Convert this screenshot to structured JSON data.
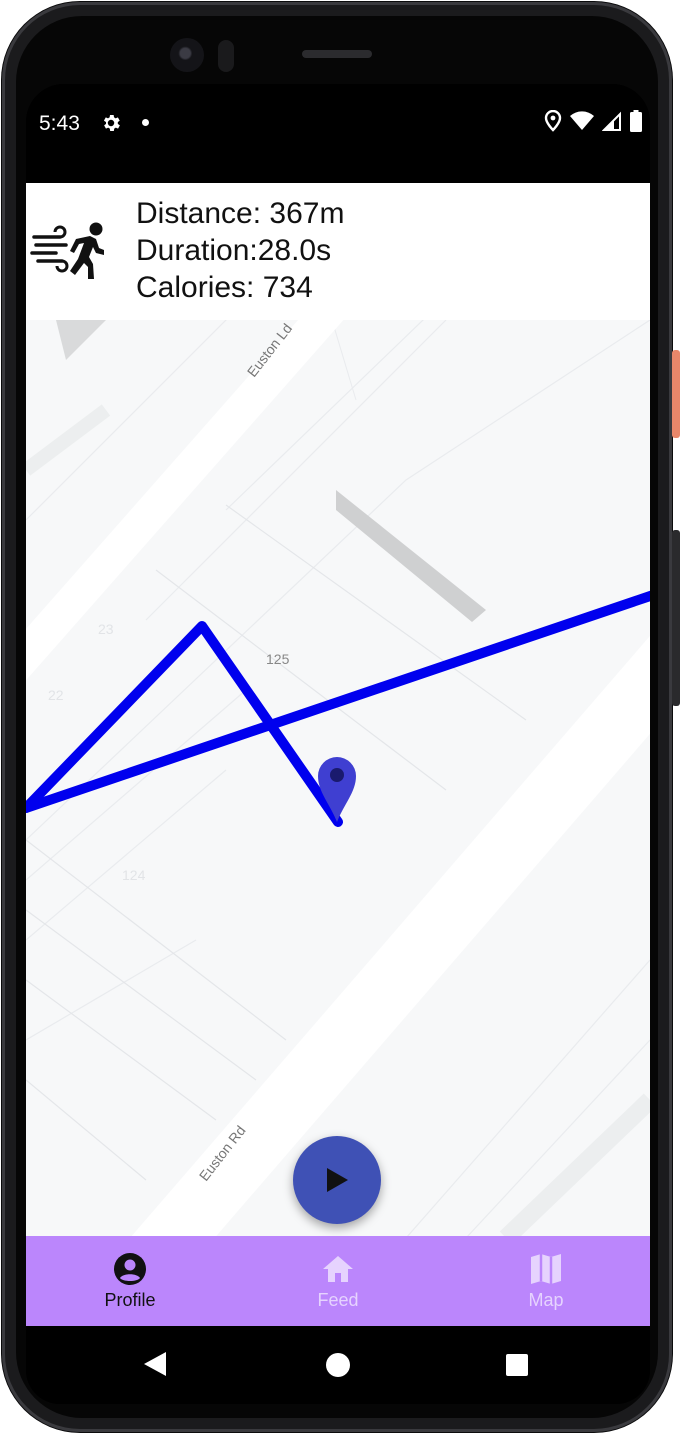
{
  "status_bar": {
    "time": "5:43",
    "icons": [
      "gear-icon",
      "notification-dot",
      "location-icon",
      "wifi-icon",
      "signal-icon",
      "battery-icon"
    ]
  },
  "stats": {
    "distance": "Distance: 367m",
    "duration": "Duration:28.0s",
    "calories": "Calories: 734",
    "icon": "runner-icon"
  },
  "map": {
    "street_labels": [
      "Euston Ld",
      "Euston Rd"
    ],
    "building_numbers": [
      "125",
      "23",
      "22",
      "124"
    ],
    "route_color": "#0000ee",
    "marker_color": "#3f3fd1",
    "marker_icon": "map-pin-icon"
  },
  "fab": {
    "icon": "play-icon",
    "color": "#3f51b5"
  },
  "bottom_nav": {
    "background": "#bb86fc",
    "items": [
      {
        "label": "Profile",
        "icon": "account-circle-icon",
        "active": true
      },
      {
        "label": "Feed",
        "icon": "home-icon",
        "active": false
      },
      {
        "label": "Map",
        "icon": "map-icon",
        "active": false
      }
    ]
  },
  "system_nav": [
    "back-icon",
    "home-circle-icon",
    "recents-icon"
  ]
}
